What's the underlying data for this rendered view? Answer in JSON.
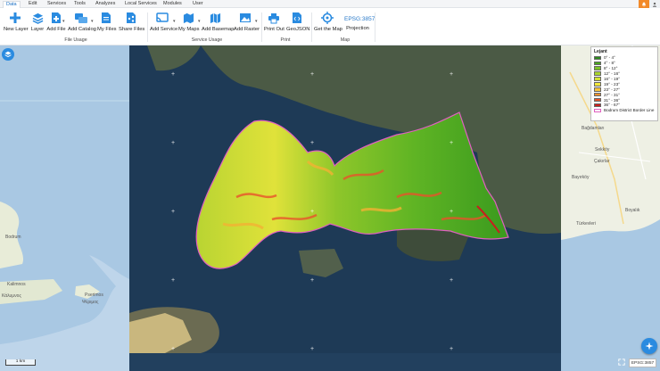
{
  "menu": {
    "items": [
      "Data",
      "Edit",
      "Services",
      "Tools",
      "Analyzes",
      "Local Services",
      "Modules",
      "User"
    ]
  },
  "toolbar": {
    "new_layer": "New Layer",
    "layer": "Layer",
    "add_file": "Add File",
    "add_catalog": "Add Catalog",
    "my_files": "My Files",
    "share_files": "Share Files",
    "group_file_usage": "File Usage",
    "add_service": "Add Service",
    "my_maps": "My Maps",
    "add_basemap": "Add Basemap",
    "add_raster": "Add Raster",
    "group_service_usage": "Service Usage",
    "print_out": "Print Out",
    "geojson": "GeoJSON",
    "group_print": "Print",
    "get_map": "Get the Map",
    "projection": "Projection",
    "group_map": "Map",
    "epsg_header": "EPSG:3857"
  },
  "legend": {
    "title": "Lejant",
    "classes": [
      {
        "label": "0° - 4°",
        "color": "#2e8b1e"
      },
      {
        "label": "4° - 8°",
        "color": "#4aa51f"
      },
      {
        "label": "8° - 12°",
        "color": "#7cc128"
      },
      {
        "label": "12° - 16°",
        "color": "#a8d42e"
      },
      {
        "label": "16° - 19°",
        "color": "#d3e234"
      },
      {
        "label": "19° - 23°",
        "color": "#f2e83a"
      },
      {
        "label": "23° - 27°",
        "color": "#f7c33a"
      },
      {
        "label": "27° - 31°",
        "color": "#f2922d"
      },
      {
        "label": "31° - 36°",
        "color": "#e6532a"
      },
      {
        "label": "36° - 67°",
        "color": "#c81e1e"
      }
    ],
    "border_label": "Bodrum District Border Line",
    "border_color": "#e060c0"
  },
  "map": {
    "places_left": [
      "Bodrum",
      "Kalimnos",
      "Κάλυμνος",
      "Pserimos",
      "Ψέριμος"
    ],
    "places_right": [
      "Bağdamları",
      "Sekköy",
      "Çakırlar",
      "Bayırköy",
      "Türkevleri",
      "Boyalık"
    ],
    "scale_label": "1 km",
    "epsg_label": "EPSG:3857"
  }
}
